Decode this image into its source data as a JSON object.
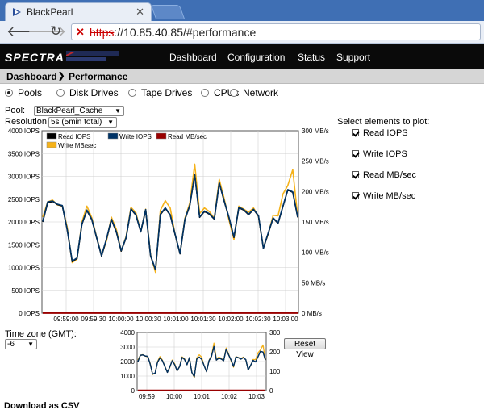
{
  "browser": {
    "tab_title": "BlackPearl",
    "url_scheme": "https",
    "url_rest": "://10.85.40.85/#performance"
  },
  "header": {
    "logo": "SPECTRA",
    "menu": [
      "Dashboard",
      "Configuration",
      "Status",
      "Support"
    ]
  },
  "breadcrumb": {
    "root": "Dashboard",
    "separator": "❯",
    "current": "Performance"
  },
  "sources": {
    "options": [
      "Pools",
      "Disk Drives",
      "Tape Drives",
      "CPUs",
      "Network"
    ],
    "selected": "Pools"
  },
  "controls": {
    "pool_label": "Pool:",
    "pool_value": "BlackPearl_Cache",
    "resolution_label": "Resolution:",
    "resolution_value": "5s (5min total)",
    "timezone_label": "Time zone (GMT):",
    "timezone_value": "-6",
    "reset_label": "Reset View",
    "csv_label": "Download as CSV"
  },
  "plot_elements": {
    "title": "Select elements to plot:",
    "items": [
      {
        "label": "Read IOPS",
        "checked": true
      },
      {
        "label": "Write IOPS",
        "checked": true
      },
      {
        "label": "Read MB/sec",
        "checked": true
      },
      {
        "label": "Write MB/sec",
        "checked": true
      }
    ]
  },
  "chart_data": [
    {
      "type": "line",
      "title": "",
      "x_tick_labels": [
        "09:59:00",
        "09:59:30",
        "10:00:00",
        "10:00:30",
        "10:01:00",
        "10:01:30",
        "10:02:00",
        "10:02:30",
        "10:03:00"
      ],
      "y_left": {
        "range": [
          0,
          4000
        ],
        "ticks": [
          "0 IOPS",
          "500 IOPS",
          "1000 IOPS",
          "1500 IOPS",
          "2000 IOPS",
          "2500 IOPS",
          "3000 IOPS",
          "3500 IOPS",
          "4000 IOPS"
        ]
      },
      "y_right": {
        "range": [
          0,
          300
        ],
        "ticks": [
          "0 MB/s",
          "50 MB/s",
          "100 MB/s",
          "150 MB/s",
          "200 MB/s",
          "250 MB/s",
          "300 MB/s"
        ]
      },
      "grid": true,
      "legend_position": "top-left",
      "series": [
        {
          "name": "Read IOPS",
          "color": "#000000",
          "axis": "left",
          "values": [
            2000,
            2420,
            2450,
            2380,
            2350,
            1820,
            1130,
            1200,
            1950,
            2250,
            2050,
            1650,
            1250,
            1620,
            2050,
            1780,
            1360,
            1650,
            2280,
            2150,
            1780,
            2260,
            1250,
            950,
            2160,
            2300,
            2150,
            1720,
            1300,
            2050,
            2360,
            3030,
            2100,
            2230,
            2170,
            2060,
            2850,
            2460,
            2090,
            1660,
            2310,
            2260,
            2160,
            2270,
            2130,
            1420,
            1750,
            2080,
            1970,
            2340,
            2700,
            2650,
            2100
          ]
        },
        {
          "name": "Write IOPS",
          "color": "#003366",
          "axis": "left",
          "values": [
            2010,
            2440,
            2460,
            2390,
            2360,
            1830,
            1140,
            1210,
            1960,
            2260,
            2060,
            1660,
            1260,
            1630,
            2060,
            1790,
            1370,
            1660,
            2290,
            2160,
            1790,
            2270,
            1260,
            960,
            2170,
            2310,
            2160,
            1730,
            1310,
            2060,
            2370,
            3040,
            2110,
            2240,
            2180,
            2070,
            2860,
            2470,
            2100,
            1670,
            2320,
            2270,
            2170,
            2280,
            2140,
            1430,
            1760,
            2090,
            1980,
            2350,
            2710,
            2660,
            2110
          ]
        },
        {
          "name": "Read MB/sec",
          "color": "#990000",
          "axis": "right",
          "values": [
            0.5,
            0.5,
            0.5,
            0.5,
            0.5,
            0.5,
            0.5,
            0.5,
            0.5,
            0.5,
            0.5,
            0.5,
            0.5,
            0.5,
            0.5,
            0.5,
            0.5,
            0.5,
            0.5,
            0.5,
            0.5,
            0.5,
            0.5,
            0.5,
            0.5,
            0.5,
            0.5,
            0.5,
            0.5,
            0.5,
            0.5,
            0.5,
            0.5,
            0.5,
            0.5,
            0.5,
            0.5,
            0.5,
            0.5,
            0.5,
            0.5,
            0.5,
            0.5,
            0.5,
            0.5,
            0.5,
            0.5,
            0.5,
            0.5,
            0.5,
            0.5,
            0.5,
            0.5
          ]
        },
        {
          "name": "Write MB/sec",
          "color": "#f5b21a",
          "axis": "right",
          "values": [
            158,
            183,
            186,
            178,
            176,
            141,
            83,
            89,
            150,
            176,
            157,
            125,
            95,
            119,
            158,
            138,
            102,
            126,
            174,
            165,
            134,
            171,
            96,
            67,
            169,
            185,
            173,
            129,
            98,
            156,
            181,
            245,
            164,
            173,
            167,
            156,
            220,
            189,
            153,
            121,
            176,
            171,
            166,
            173,
            159,
            108,
            130,
            161,
            160,
            196,
            210,
            236,
            159
          ]
        }
      ]
    },
    {
      "type": "line",
      "title": "",
      "x_tick_labels": [
        "09:59",
        "10:00",
        "10:01",
        "10:02",
        "10:03"
      ],
      "y_left": {
        "range": [
          0,
          4000
        ],
        "ticks": [
          "0",
          "1000",
          "2000",
          "3000",
          "4000"
        ]
      },
      "y_right": {
        "range": [
          0,
          300
        ],
        "ticks": [
          "0",
          "100",
          "200",
          "300"
        ]
      },
      "grid": true,
      "series_ref": "same series as main chart"
    }
  ]
}
